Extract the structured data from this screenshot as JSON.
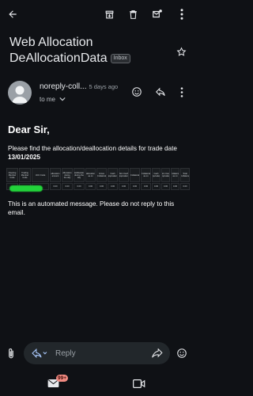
{
  "subject": {
    "title": "Web Allocation DeAllocationData",
    "label_chip": "Inbox"
  },
  "sender": {
    "name": "noreply-coll...",
    "time": "5 days ago",
    "recipient": "to me"
  },
  "message": {
    "greeting": "Dear Sir,",
    "intro": "Please find the allocation/deallocation details for trade date",
    "trade_date": "13/01/2025",
    "table_headers": [
      "Clearing Member Code",
      "Trading Member Code",
      "UCC Code",
      "allocation amount",
      "Allocation during the day",
      "DeAllocation during the day",
      "allocation as on",
      "Gross Collateral",
      "Cash Equivalent",
      "Non Cash Equivalent",
      "Collateral",
      "Collateral as on",
      "Cash Equivalent",
      "Non Cash Equivalent",
      "Collateral as on",
      "Total Collateral"
    ],
    "table_values": [
      "",
      "",
      "",
      "0.00",
      "0.00",
      "0.00",
      "0.00",
      "0.00",
      "0.00",
      "0.00",
      "0.00",
      "0.00",
      "0.00",
      "0.00",
      "0.00",
      "0.00"
    ],
    "footer": "This is an automated message. Please do not reply to this email."
  },
  "compose": {
    "reply_placeholder": "Reply"
  },
  "nav": {
    "mail_badge": "99+"
  },
  "icons": [
    "back-arrow-icon",
    "archive-icon",
    "delete-icon",
    "mark-unread-icon",
    "more-vert-icon",
    "star-icon",
    "emoji-icon",
    "reply-icon",
    "attach-icon",
    "reply-all-icon",
    "forward-icon",
    "mail-icon",
    "video-icon"
  ]
}
